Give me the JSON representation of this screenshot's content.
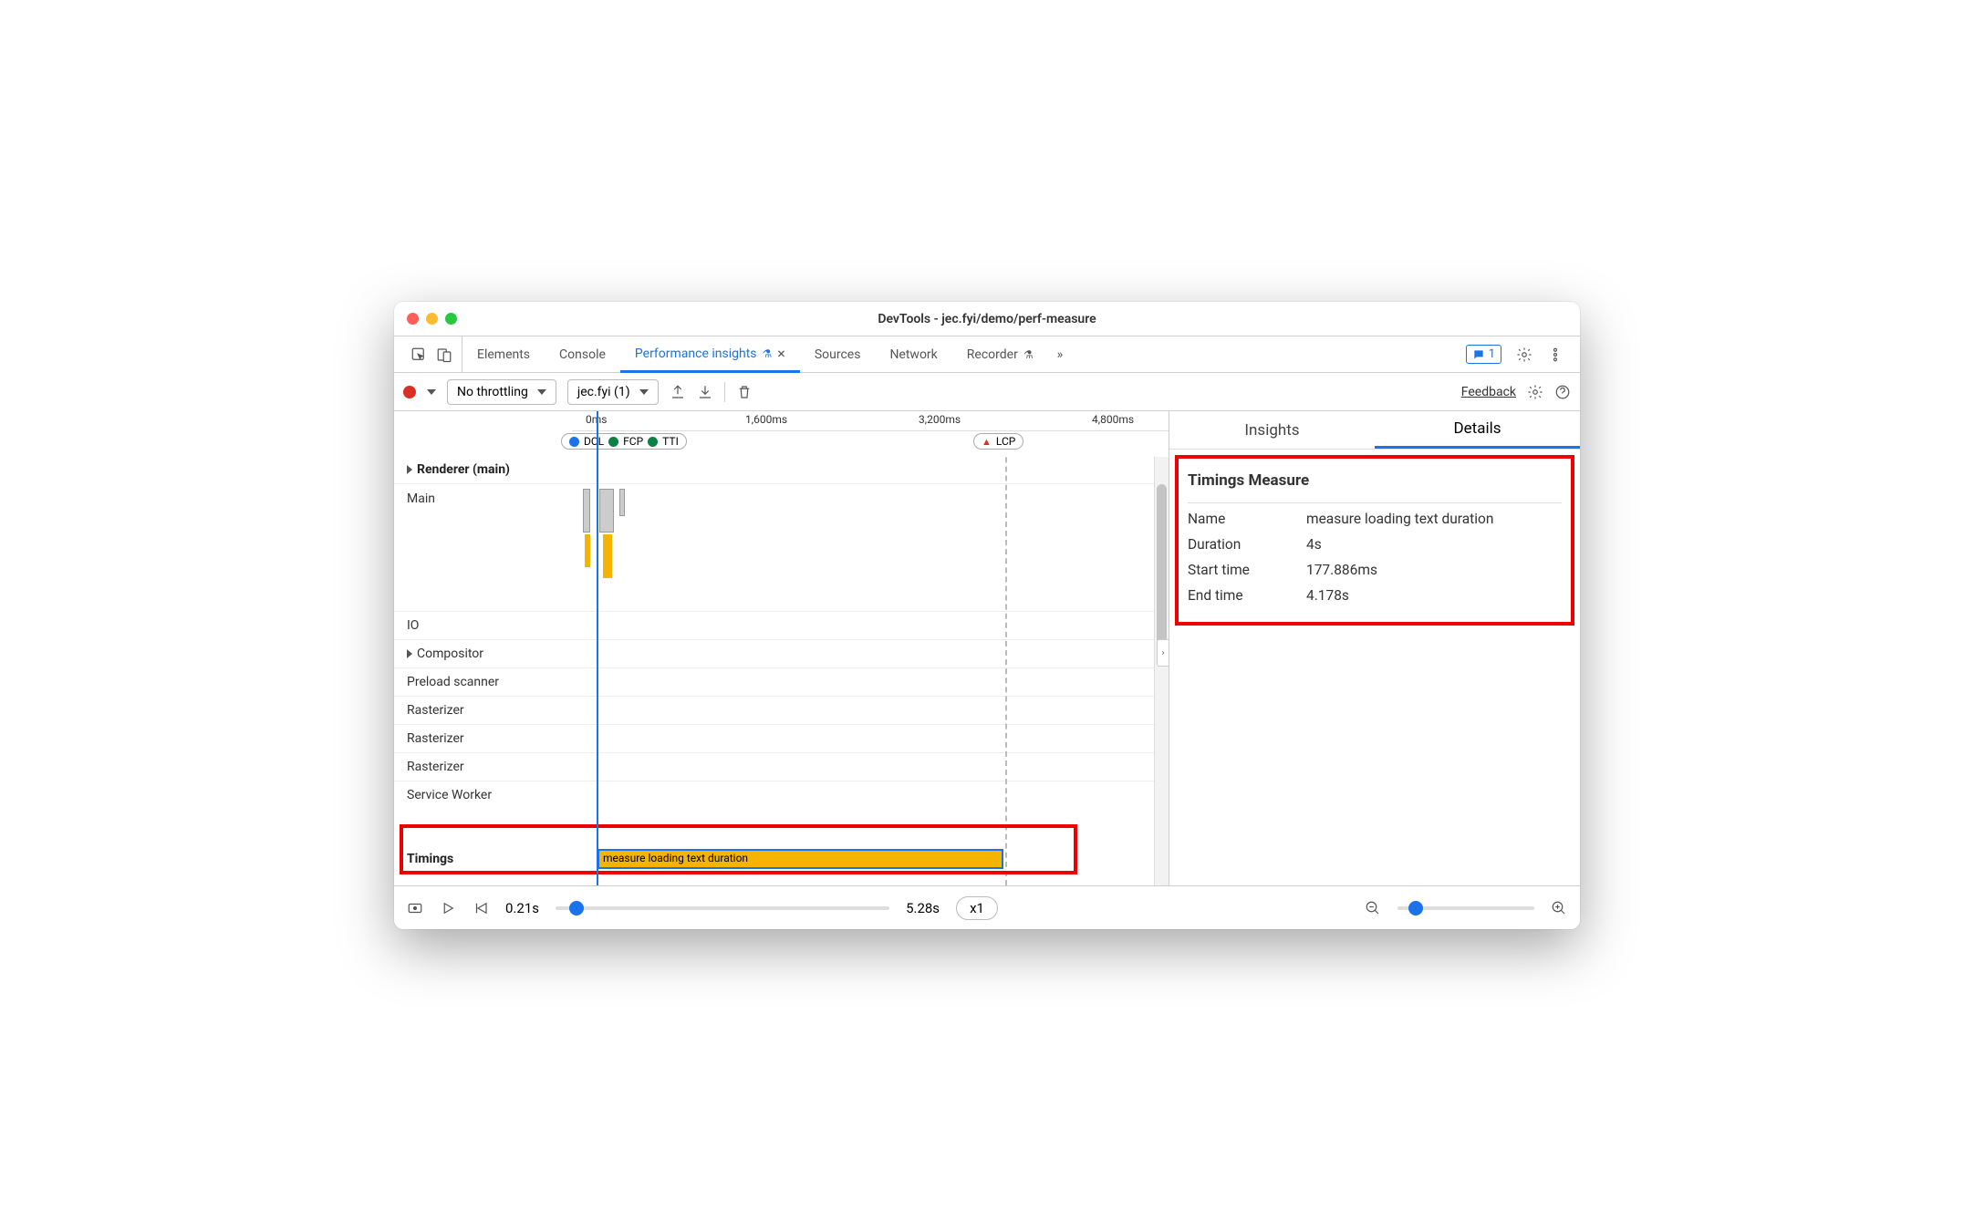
{
  "window": {
    "title": "DevTools - jec.fyi/demo/perf-measure"
  },
  "tabs": {
    "elements": "Elements",
    "console": "Console",
    "perf_insights": "Performance insights",
    "sources": "Sources",
    "network": "Network",
    "recorder": "Recorder",
    "more": "»",
    "issue_count": "1"
  },
  "toolbar": {
    "throttling": "No throttling",
    "recording": "jec.fyi (1)",
    "feedback": "Feedback"
  },
  "ruler": {
    "t0": "0ms",
    "t1": "1,600ms",
    "t2": "3,200ms",
    "t3": "4,800ms"
  },
  "markers": {
    "dcl": "DCL",
    "fcp": "FCP",
    "tti": "TTI",
    "lcp": "LCP"
  },
  "url_path": "/demo/perf-measure",
  "url_host": "https://jec.fyi",
  "tracks": {
    "renderer": "Renderer (main)",
    "main": "Main",
    "io": "IO",
    "compositor": "Compositor",
    "preload": "Preload scanner",
    "rasterizer": "Rasterizer",
    "service_worker": "Service Worker",
    "timings": "Timings"
  },
  "timing_bar_label": "measure loading text duration",
  "right": {
    "insights": "Insights",
    "details": "Details",
    "title": "Timings Measure",
    "rows": {
      "name_k": "Name",
      "name_v": "measure loading text duration",
      "dur_k": "Duration",
      "dur_v": "4s",
      "st_k": "Start time",
      "st_v": "177.886ms",
      "et_k": "End time",
      "et_v": "4.178s"
    }
  },
  "footer": {
    "start": "0.21s",
    "end": "5.28s",
    "speed": "x1"
  }
}
